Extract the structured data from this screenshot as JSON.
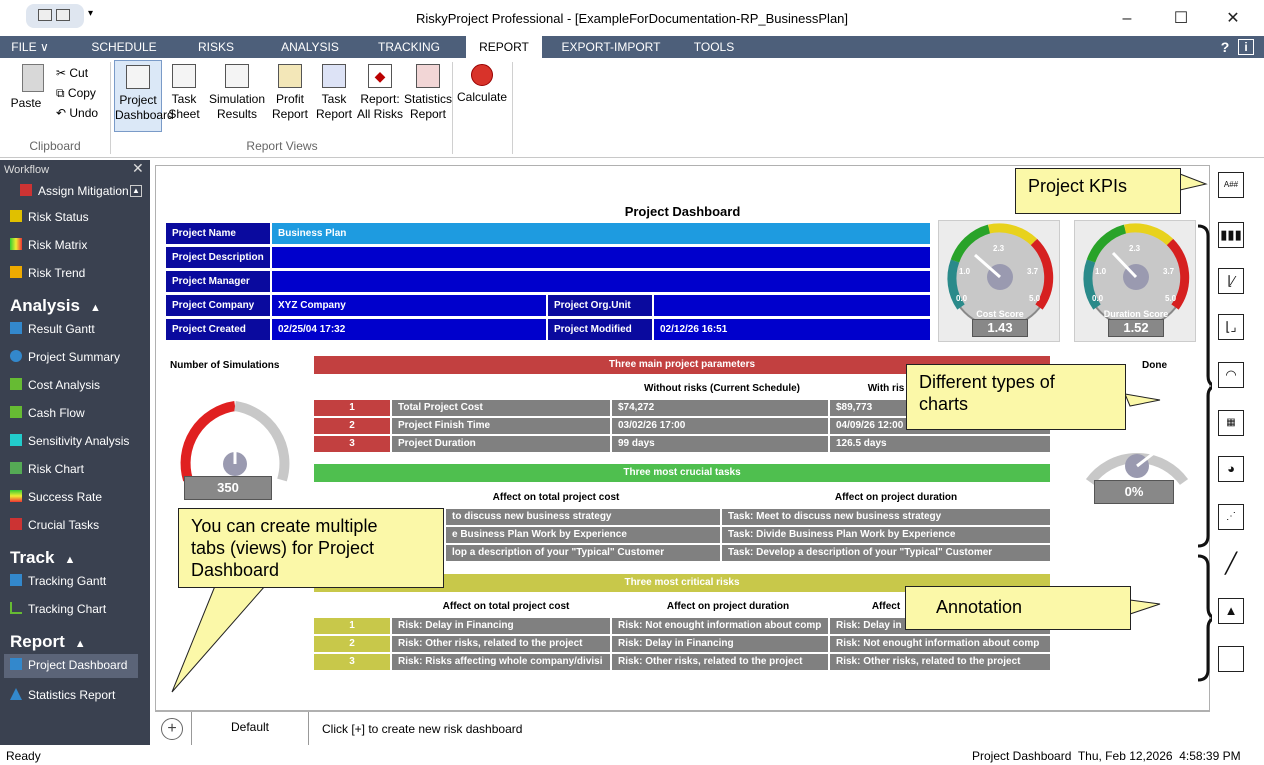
{
  "window": {
    "title": "RiskyProject Professional - [ExampleForDocumentation-RP_BusinessPlan]",
    "minimize": "–",
    "maximize": "☐",
    "close": "✕"
  },
  "ribbon_tabs": [
    "FILE ∨",
    "SCHEDULE",
    "RISKS",
    "ANALYSIS",
    "TRACKING",
    "REPORT",
    "EXPORT-IMPORT",
    "TOOLS"
  ],
  "help": "?",
  "info": "i",
  "clipboard": {
    "paste": "Paste",
    "cut": "Cut",
    "copy": "Copy",
    "undo": "Undo",
    "group": "Clipboard"
  },
  "report_views": {
    "buttons": [
      {
        "line1": "Project",
        "line2": "Dashboard"
      },
      {
        "line1": "Task",
        "line2": "Sheet"
      },
      {
        "line1": "Simulation",
        "line2": "Results"
      },
      {
        "line1": "Profit",
        "line2": "Report"
      },
      {
        "line1": "Task",
        "line2": "Report"
      },
      {
        "line1": "Report:",
        "line2": "All Risks"
      },
      {
        "line1": "Statistics",
        "line2": "Report"
      }
    ],
    "group": "Report Views",
    "calculate": "Calculate"
  },
  "sidebar": {
    "title": "Workflow",
    "items_top": [
      "Assign Mitigation",
      "Risk Status",
      "Risk Matrix",
      "Risk Trend"
    ],
    "analysis_head": "Analysis",
    "analysis": [
      "Result Gantt",
      "Project Summary",
      "Cost Analysis",
      "Cash Flow",
      "Sensitivity Analysis",
      "Risk Chart",
      "Success Rate",
      "Crucial Tasks"
    ],
    "track_head": "Track",
    "track": [
      "Tracking Gantt",
      "Tracking Chart"
    ],
    "report_head": "Report",
    "report": [
      "Project Dashboard",
      "Statistics Report"
    ]
  },
  "dashboard": {
    "title": "Project Dashboard",
    "project_name_label": "Project Name",
    "project_name": "Business Plan",
    "desc_label": "Project Description",
    "manager_label": "Project Manager",
    "company_label": "Project Company",
    "company": "XYZ Company",
    "orgunit_label": "Project Org.Unit",
    "created_label": "Project Created",
    "created": "02/25/04 17:32",
    "modified_label": "Project Modified",
    "modified": "02/12/26 16:51",
    "cost_gauge": {
      "label": "Cost Score",
      "value": "1.43",
      "t0": "0.0",
      "t1": "1.0",
      "t2": "2.3",
      "t3": "3.7",
      "t4": "5.0",
      "level": 0.29
    },
    "duration_gauge": {
      "label": "Duration Score",
      "value": "1.52",
      "t0": "0.0",
      "t1": "1.0",
      "t2": "2.3",
      "t3": "3.7",
      "t4": "5.0",
      "level": 0.3
    },
    "num_sim_label": "Number of Simulations",
    "num_sim": "350",
    "done_label": "Done",
    "done_value": "0%",
    "params_header": "Three main project parameters",
    "without_risks": "Without risks (Current Schedule)",
    "with_risks": "With ris",
    "params": [
      {
        "n": "1",
        "name": "Total Project Cost",
        "a": "$74,272",
        "b": "$89,773"
      },
      {
        "n": "2",
        "name": "Project Finish Time",
        "a": "03/02/26 17:00",
        "b": "04/09/26 12:00"
      },
      {
        "n": "3",
        "name": "Project Duration",
        "a": "99 days",
        "b": "126.5 days"
      }
    ],
    "crucial_header": "Three most crucial tasks",
    "crucial_cost_hdr": "Affect on total project cost",
    "crucial_dur_hdr": "Affect on project duration",
    "crucial": [
      {
        "a": "to discuss new business strategy",
        "b": "Task: Meet to discuss new business strategy"
      },
      {
        "a": "e Business Plan Work by Experience",
        "b": "Task: Divide Business Plan Work by Experience"
      },
      {
        "a": "lop a description of your \"Typical\" Customer",
        "b": "Task: Develop a description of your \"Typical\" Customer"
      }
    ],
    "critical_header": "Three most critical risks",
    "critical_cost_hdr": "Affect on total project cost",
    "critical_dur_hdr": "Affect on project duration",
    "critical_third_hdr": "Affect",
    "critical": [
      {
        "n": "1",
        "a": "Risk: Delay in Financing",
        "b": "Risk: Not enought information about comp",
        "c": "Risk: Delay in Fi"
      },
      {
        "n": "2",
        "a": "Risk: Other risks, related to the project",
        "b": "Risk: Delay in Financing",
        "c": "Risk: Not enought information about comp"
      },
      {
        "n": "3",
        "a": "Risk: Risks affecting whole company/divisi",
        "b": "Risk: Other risks, related to the project",
        "c": "Risk: Other risks, related to the project"
      }
    ]
  },
  "callouts": {
    "kpis": "Project KPIs",
    "charts_line1": "Different types of",
    "charts_line2": "charts",
    "tabs_line1": "You can create multiple",
    "tabs_line2": "tabs (views) for Project",
    "tabs_line3": "Dashboard",
    "annotation": "Annotation"
  },
  "bottom": {
    "add": "+",
    "tab": "Default",
    "hint": "Click [+] to create new risk dashboard"
  },
  "status": {
    "left": "Ready",
    "right": "Project Dashboard  Thu, Feb 12,2026  4:58:39 PM"
  },
  "right_icons": [
    "kpi-icon",
    "bar-chart-icon",
    "line-chart-icon",
    "area-chart-icon",
    "gauge-icon",
    "grid-chart-icon",
    "pie-chart-icon",
    "scatter-chart-icon",
    "line-annotation-icon",
    "image-annotation-icon",
    "rectangle-annotation-icon"
  ],
  "colors": {
    "ribbon": "#4d5f7a",
    "sidebar": "#3a4150",
    "label_blue": "#0a0a9e",
    "callout": "#fbf8a8"
  }
}
